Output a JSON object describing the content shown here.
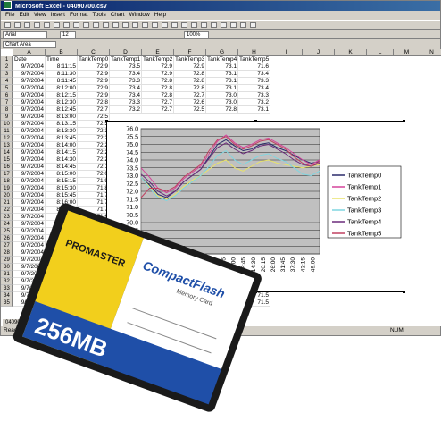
{
  "title": "Microsoft Excel - 04090700.csv",
  "menu": [
    "File",
    "Edit",
    "View",
    "Insert",
    "Format",
    "Tools",
    "Chart",
    "Window",
    "Help"
  ],
  "font_name": "Arial",
  "font_size": "12",
  "zoom": "100%",
  "name_box": "Chart Area",
  "columns": [
    "A",
    "B",
    "C",
    "D",
    "E",
    "F",
    "G",
    "H",
    "I",
    "J",
    "K",
    "L",
    "M",
    "N"
  ],
  "rows": [
    [
      "Date",
      "Time",
      "TankTemp0",
      "TankTemp1",
      "TankTemp2",
      "TankTemp3",
      "TankTemp4",
      "TankTemp5"
    ],
    [
      "9/7/2004",
      "8:11:15",
      "72.9",
      "73.5",
      "72.9",
      "72.9",
      "73.1",
      "71.6"
    ],
    [
      "9/7/2004",
      "8:11:30",
      "72.9",
      "73.4",
      "72.9",
      "72.8",
      "73.1",
      "73.4"
    ],
    [
      "9/7/2004",
      "8:11:45",
      "72.9",
      "73.3",
      "72.8",
      "72.8",
      "73.1",
      "73.3"
    ],
    [
      "9/7/2004",
      "8:12:00",
      "72.9",
      "73.4",
      "72.8",
      "72.8",
      "73.1",
      "73.4"
    ],
    [
      "9/7/2004",
      "8:12:15",
      "72.9",
      "73.4",
      "72.8",
      "72.7",
      "73.0",
      "73.3"
    ],
    [
      "9/7/2004",
      "8:12:30",
      "72.8",
      "73.3",
      "72.7",
      "72.6",
      "73.0",
      "73.2"
    ],
    [
      "9/7/2004",
      "8:12:45",
      "72.7",
      "73.2",
      "72.7",
      "72.5",
      "72.8",
      "73.1"
    ],
    [
      "9/7/2004",
      "8:13:00",
      "72.5",
      "",
      "",
      "",
      "",
      ""
    ],
    [
      "9/7/2004",
      "8:13:15",
      "72.5",
      "",
      "",
      "",
      "",
      ""
    ],
    [
      "9/7/2004",
      "8:13:30",
      "72.3",
      "",
      "",
      "",
      "",
      ""
    ],
    [
      "9/7/2004",
      "8:13:45",
      "72.2",
      "",
      "",
      "",
      "",
      ""
    ],
    [
      "9/7/2004",
      "8:14:00",
      "72.2",
      "",
      "",
      "",
      "",
      ""
    ],
    [
      "9/7/2004",
      "8:14:15",
      "72.2",
      "",
      "",
      "",
      "",
      ""
    ],
    [
      "9/7/2004",
      "8:14:30",
      "72.2",
      "",
      "",
      "",
      "",
      ""
    ],
    [
      "9/7/2004",
      "8:14:45",
      "72.1",
      "",
      "",
      "",
      "",
      ""
    ],
    [
      "9/7/2004",
      "8:15:00",
      "72.0",
      "",
      "",
      "",
      "",
      ""
    ],
    [
      "9/7/2004",
      "8:15:15",
      "71.9",
      "",
      "",
      "",
      "",
      ""
    ],
    [
      "9/7/2004",
      "8:15:30",
      "71.8",
      "",
      "",
      "",
      "",
      ""
    ],
    [
      "9/7/2004",
      "8:15:45",
      "71.7",
      "",
      "",
      "",
      "",
      ""
    ],
    [
      "9/7/2004",
      "8:16:00",
      "71.7",
      "",
      "",
      "",
      "",
      ""
    ],
    [
      "9/7/2004",
      "8:16:15",
      "71.7",
      "",
      "",
      "",
      "",
      ""
    ],
    [
      "9/7/2004",
      "8:16:30",
      "71.6",
      "",
      "",
      "",
      "",
      ""
    ],
    [
      "9/7/2004",
      "8:16:45",
      "71.6",
      "",
      "",
      "",
      "",
      ""
    ],
    [
      "9/7/2004",
      "8:17:00",
      "71.5",
      "",
      "",
      "",
      "",
      ""
    ],
    [
      "9/7/2004",
      "8:17:15",
      "71.4",
      "",
      "",
      "",
      "",
      ""
    ],
    [
      "9/7/2004",
      "8:17:30",
      "71.3",
      "",
      "",
      "",
      "",
      ""
    ],
    [
      "9/7/2004",
      "8:17:45",
      "71.3",
      "",
      "",
      "",
      "",
      ""
    ],
    [
      "9/7/2004",
      "8:18:00",
      "71.3",
      "",
      "",
      "",
      "",
      ""
    ],
    [
      "9/7/2004",
      "8:18:15",
      "71.2",
      "",
      "",
      "",
      "",
      "71.7"
    ],
    [
      "9/7/2004",
      "8:18:30",
      "71.1",
      "",
      "",
      "",
      "",
      "71.6"
    ],
    [
      "9/7/2004",
      "8:18:45",
      "71.1",
      "",
      "",
      "",
      "",
      "71.6"
    ],
    [
      "9/7/2004",
      "8:19:00",
      "71.1",
      "",
      "",
      "",
      "",
      "71.6"
    ],
    [
      "9/7/2004",
      "8:19:15",
      "71.0",
      "",
      "",
      "",
      "",
      "71.5"
    ],
    [
      "9/7/2004",
      "8:19:30",
      "71.0",
      "",
      "",
      "",
      "",
      "71.5"
    ]
  ],
  "sheet_tab": "04090",
  "status_ready": "Ready",
  "status_num": "NUM",
  "chart_data": {
    "type": "line",
    "ylim": [
      68.0,
      76.0
    ],
    "yticks": [
      "76.0",
      "75.5",
      "75.0",
      "74.5",
      "74.0",
      "73.5",
      "73.0",
      "72.5",
      "72.0",
      "71.5",
      "71.0",
      "70.5",
      "70.0",
      "69.5",
      "69.0",
      "68.5",
      "68.0"
    ],
    "xticks": [
      "8:11:15",
      "8:15:00",
      "8:18:45",
      "8:22:30",
      "8:26:15",
      "8:30:00",
      "8:33:45",
      "8:37:30",
      "8:41:15",
      "8:45:00",
      "8:48:45",
      "8:52:30",
      "8:56:15",
      "9:00:00",
      "9:03:45",
      "9:07:30",
      "9:11:15",
      "9:15:00",
      "9:18:45",
      "9:22:30",
      "9:26:15",
      "9:30:00"
    ],
    "xtick_display": [
      "11:15",
      "17:00",
      "22:45",
      "28:30",
      "34:15",
      "40:00",
      "45:45",
      "51:30",
      "57:15",
      "03:00",
      "08:45",
      "14:30",
      "20:15",
      "26:00",
      "31:45",
      "37:30",
      "43:15",
      "49:00"
    ],
    "legend_position": "right",
    "series": [
      {
        "name": "TankTemp0",
        "color": "#2a2a6a",
        "values": [
          72.9,
          72.4,
          71.8,
          71.6,
          72.0,
          72.6,
          73.0,
          73.4,
          74.2,
          75.0,
          75.3,
          74.9,
          74.6,
          74.7,
          75.0,
          75.1,
          74.8,
          74.6,
          74.3,
          74.0,
          73.8,
          73.9
        ]
      },
      {
        "name": "TankTemp1",
        "color": "#d4449a",
        "values": [
          73.5,
          72.9,
          72.2,
          71.9,
          72.2,
          72.8,
          73.2,
          73.6,
          74.4,
          75.2,
          75.6,
          75.1,
          74.8,
          75.0,
          75.3,
          75.4,
          75.1,
          74.8,
          74.4,
          74.0,
          73.7,
          74.0
        ]
      },
      {
        "name": "TankTemp2",
        "color": "#e8e26a",
        "values": [
          72.9,
          72.3,
          71.7,
          71.5,
          71.8,
          72.3,
          72.7,
          73.0,
          73.4,
          73.8,
          74.0,
          73.5,
          73.3,
          73.6,
          73.9,
          74.0,
          73.8,
          73.7,
          73.6,
          73.5,
          73.6,
          73.7
        ]
      },
      {
        "name": "TankTemp3",
        "color": "#7fd6e0",
        "values": [
          72.9,
          72.2,
          71.6,
          71.4,
          71.7,
          72.2,
          72.6,
          73.0,
          73.6,
          74.3,
          74.6,
          74.0,
          73.7,
          74.0,
          74.3,
          74.4,
          74.1,
          73.9,
          73.5,
          73.1,
          73.0,
          73.3
        ]
      },
      {
        "name": "TankTemp4",
        "color": "#6a2a7a",
        "values": [
          73.1,
          72.6,
          72.0,
          71.7,
          72.0,
          72.6,
          73.0,
          73.4,
          74.1,
          74.8,
          75.1,
          74.7,
          74.4,
          74.6,
          74.9,
          75.0,
          74.7,
          74.4,
          74.0,
          73.7,
          73.6,
          73.8
        ]
      },
      {
        "name": "TankTemp5",
        "color": "#c04060",
        "values": [
          71.6,
          72.2,
          72.2,
          72.0,
          72.3,
          72.9,
          73.3,
          73.7,
          74.6,
          75.3,
          75.5,
          75.0,
          74.7,
          74.9,
          75.2,
          75.3,
          75.0,
          74.7,
          74.2,
          73.8,
          73.6,
          73.9
        ]
      }
    ]
  },
  "card": {
    "brand": "PROMASTER",
    "product": "CompactFlash",
    "subtitle": "Memory Card",
    "capacity": "256MB",
    "colors": {
      "body": "#1a1a1a",
      "yellow": "#f2cf1c",
      "blue": "#1f4fa8",
      "white": "#ffffff"
    }
  }
}
